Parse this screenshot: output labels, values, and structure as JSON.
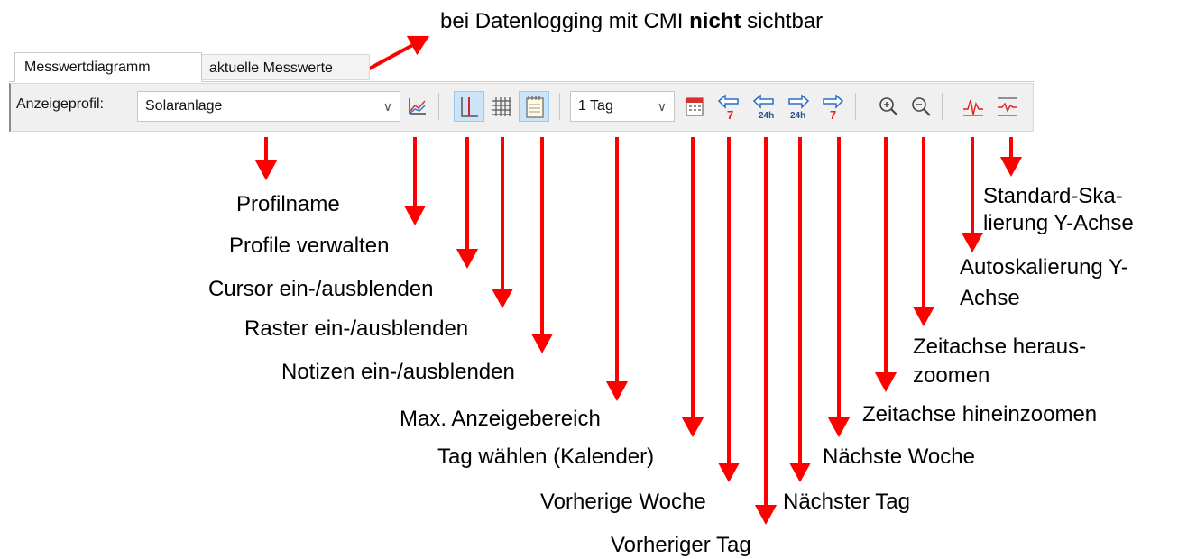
{
  "note": {
    "before": "bei Datenlogging mit CMI ",
    "bold": "nicht",
    "after": " sichtbar"
  },
  "tabs": [
    {
      "label": "Messwertdiagramm",
      "active": true
    },
    {
      "label": "aktuelle Messwerte",
      "active": false
    }
  ],
  "toolbar": {
    "profile_label": "Anzeigeprofil:",
    "profile_value": "Solaranlage",
    "range_value": "1 Tag",
    "chevron": "∨"
  },
  "icons": [
    "profile-chart-icon",
    "cursor-icon",
    "grid-icon",
    "notes-icon",
    "calendar-icon",
    "previous-week-icon",
    "previous-day-icon",
    "next-day-icon",
    "next-week-icon",
    "zoom-in-icon",
    "zoom-out-icon",
    "autoscale-icon",
    "standard-scale-icon"
  ],
  "labels": {
    "profile_name": "Profilname",
    "manage_profiles": "Profile verwalten",
    "cursor": "Cursor ein-/ausblenden",
    "grid": "Raster ein-/ausblenden",
    "notes": "Notizen ein-/ausblenden",
    "max_range": "Max. Anzeigebereich",
    "choose_day": "Tag wählen (Kalender)",
    "prev_week": "Vorherige Woche",
    "prev_day": "Vorheriger Tag",
    "next_day": "Nächster Tag",
    "next_week": "Nächste Woche",
    "zoom_in": "Zeitachse hineinzoomen",
    "zoom_out_1": "Zeitachse heraus-",
    "zoom_out_2": "zoomen",
    "autoscale_1": "Autoskalierung Y-",
    "autoscale_2": "Achse",
    "standard_1": "Standard-Ska-",
    "standard_2": "lierung Y-Achse"
  },
  "colors": {
    "arrow": "#ff0000",
    "pressed": "#cce4f7",
    "toolbar": "#f0f0f0"
  }
}
